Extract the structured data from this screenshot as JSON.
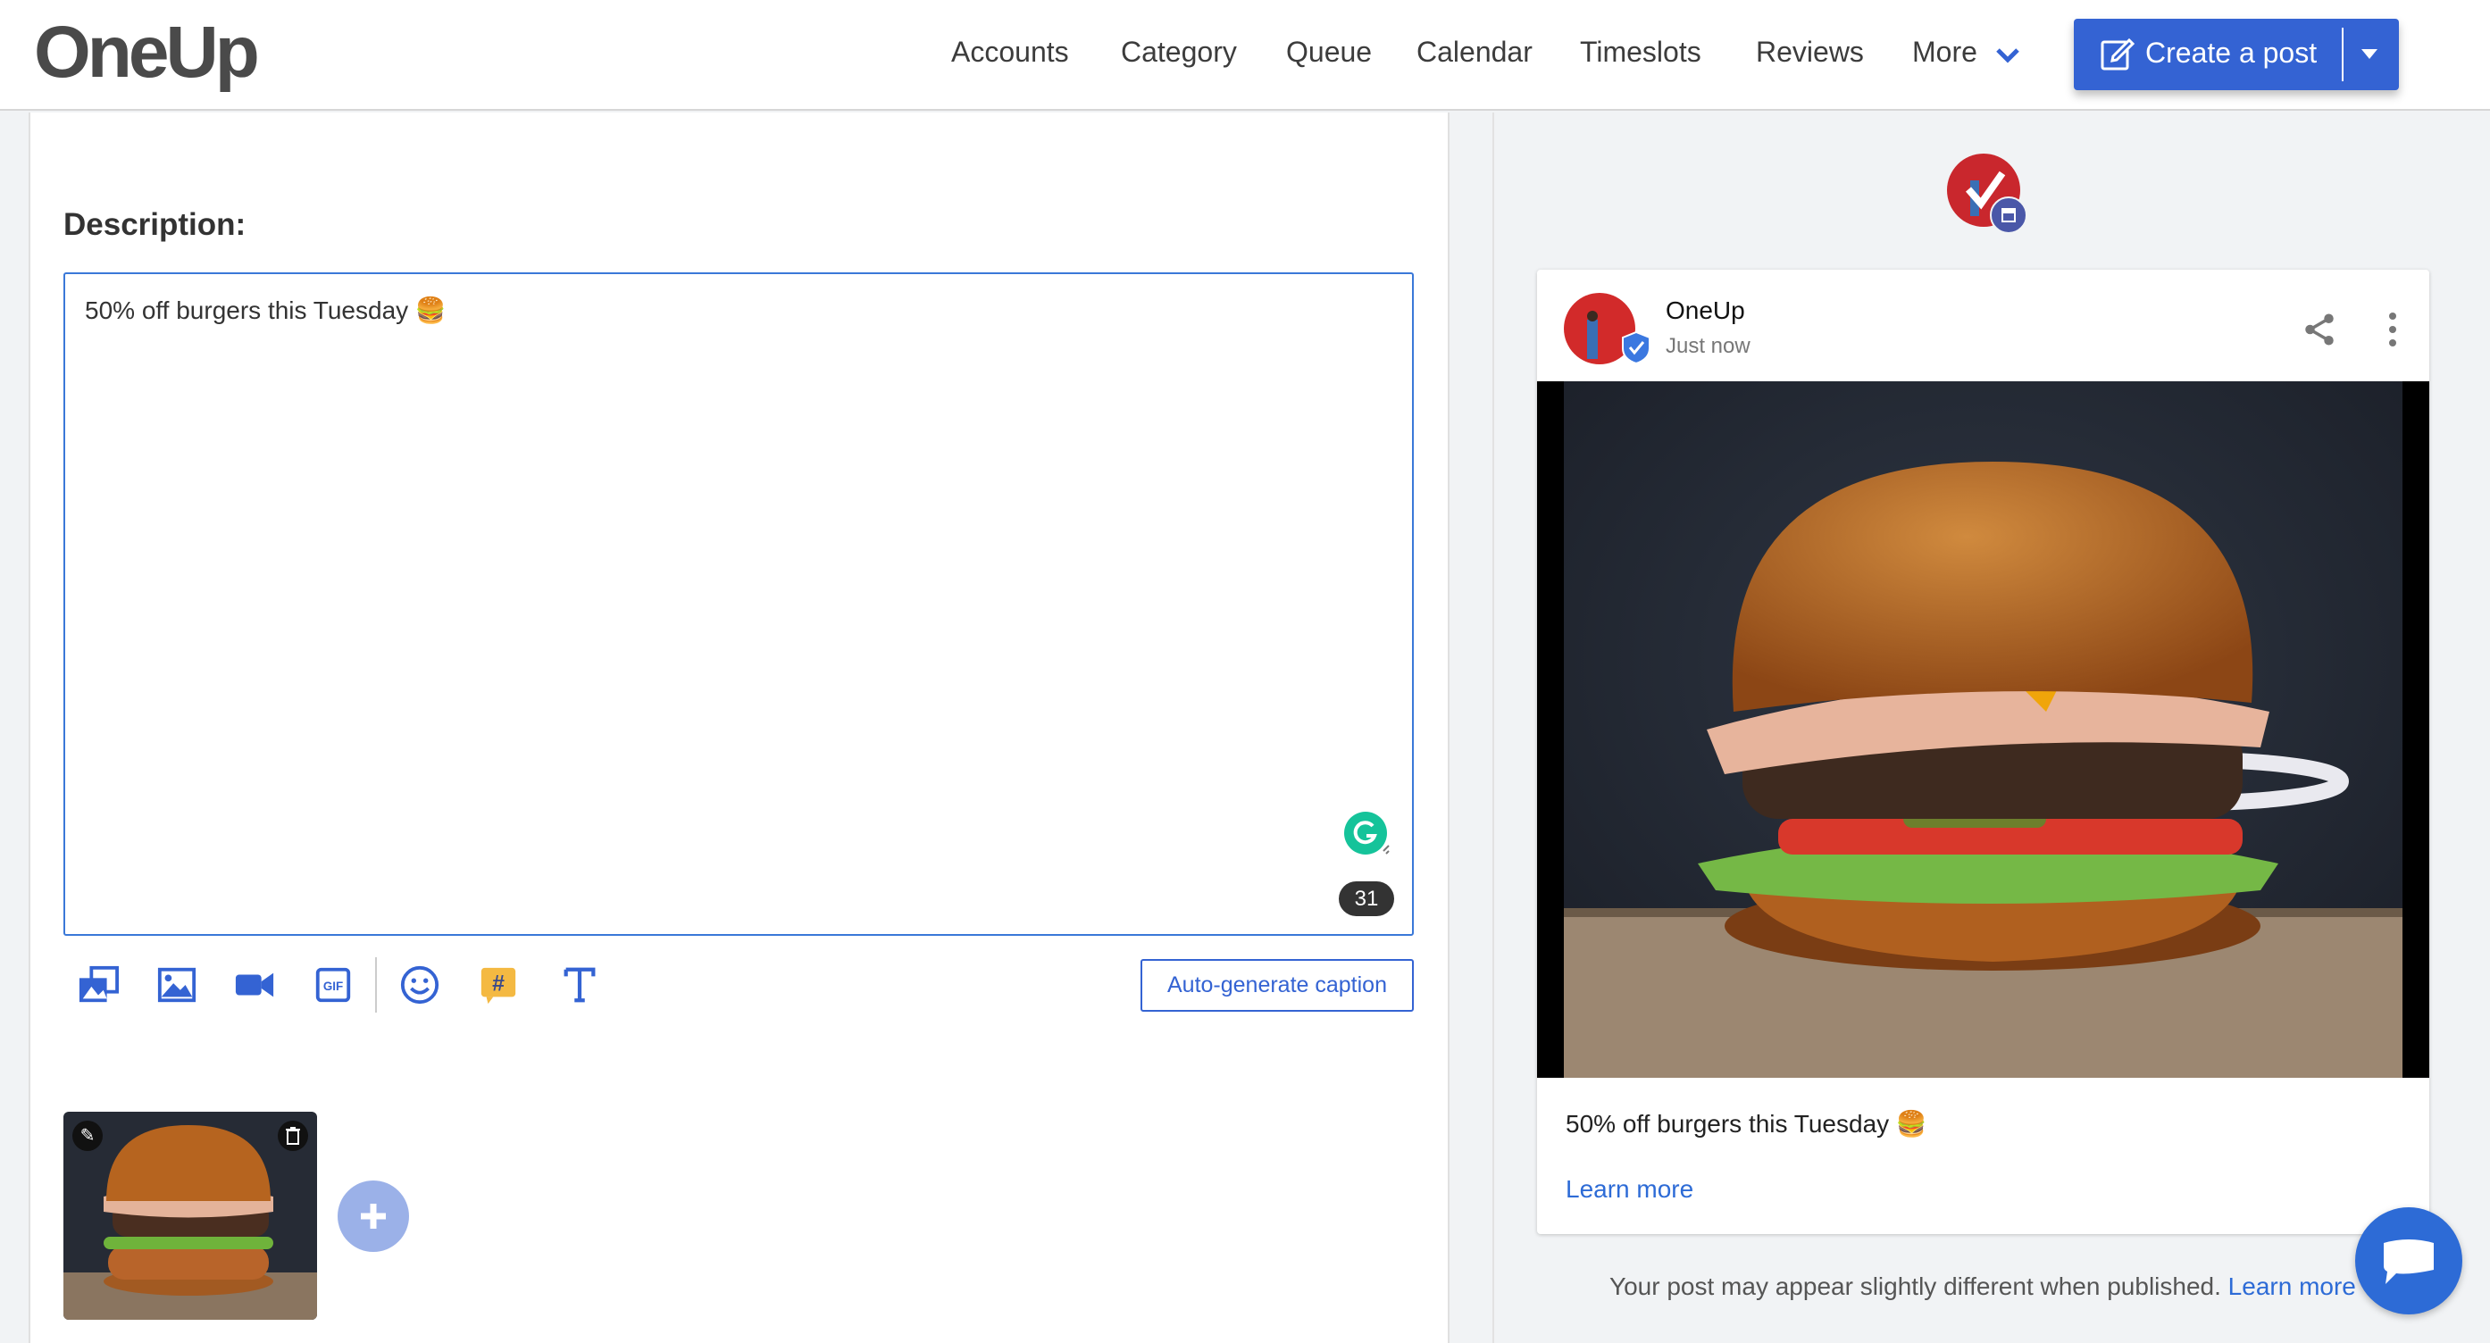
{
  "header": {
    "logo": "OneUp",
    "nav": [
      "Accounts",
      "Category",
      "Queue",
      "Calendar",
      "Timeslots",
      "Reviews",
      "More"
    ],
    "create_label": "Create a post"
  },
  "editor": {
    "description_label": "Description:",
    "description_text": "50% off burgers this Tuesday 🍔",
    "char_count": "31",
    "autogen_label": "Auto-generate caption",
    "tools": [
      "media-library-icon",
      "image-icon",
      "video-icon",
      "gif-icon",
      "emoji-icon",
      "hashtag-icon",
      "text-format-icon"
    ]
  },
  "preview": {
    "account_name": "OneUp",
    "time": "Just now",
    "caption": "50% off burgers this Tuesday 🍔",
    "cta": "Learn more",
    "footer_text": "Your post may appear slightly different when published.",
    "footer_link": "Learn more"
  },
  "colors": {
    "accent": "#3463d3",
    "link": "#2d6bd6",
    "hashtag": "#f4b942"
  }
}
